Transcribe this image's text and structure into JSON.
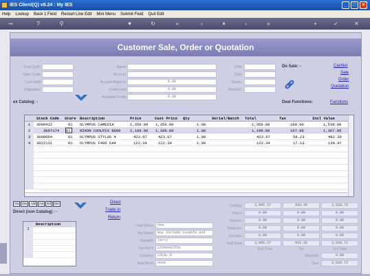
{
  "window": {
    "title": "IES Client(Q) v8.24 : My IES"
  },
  "menu": [
    "Help",
    "Lookup",
    "Back 1 Field",
    "Restart Line Edit",
    "Mini Menu",
    "Submit Field",
    "Quit Edit"
  ],
  "page": {
    "heading": "Customer Sale, Order or Quotation"
  },
  "customer_labels": {
    "find_cust": "Find Cust?",
    "sales_code": "Sales Code",
    "cust_ord": "Cust Ord#",
    "origination": "Origination",
    "name": "Name",
    "account": "Account",
    "account_balance": "Account Balance",
    "credit_limit": "Credit Limit",
    "available_credit": "Available Credit",
    "crm": "CRM",
    "club": "Club",
    "expiry": "Expiry",
    "directive": "Directive"
  },
  "customer_values": {
    "account_balance": "0.00",
    "credit_limit": "0.00",
    "available_credit": "0.00"
  },
  "do_sale": {
    "label": "Do Sale: -",
    "links": [
      "Cashier",
      "Sale",
      "Order",
      "Quotation"
    ]
  },
  "deal_functions": {
    "label": "Deal Functions:",
    "link": "Functions"
  },
  "catalog_label": "ex Catalog: -",
  "grid": {
    "headers": [
      "Stock Code",
      "Store",
      "Description",
      "Price",
      "Cust Price",
      "Qty",
      "Serial/Batch",
      "Total",
      "Tax",
      "Incl Value"
    ],
    "rows": [
      {
        "n": "1",
        "stock": "3008412",
        "store": "01",
        "desc": "OLYMPUS CAMEDIA",
        "price": "1,350.00",
        "cust_price": "1,350.00",
        "qty": "1.00",
        "total": "1,350.00",
        "tax": "189.00",
        "incl": "1,539.00"
      },
      {
        "n": "2",
        "stock": "3007174",
        "store": "01",
        "desc": "NIKON COOLPIX 8800",
        "price": "1,199.96",
        "cust_price": "1,199.96",
        "qty": "1.00",
        "total": "1,199.96",
        "tax": "167.99",
        "incl": "1,367.95"
      },
      {
        "n": "3",
        "stock": "3008064",
        "store": "01",
        "desc": "OLYMPUS STYLUS 4",
        "price": "423.07",
        "cust_price": "423.07",
        "qty": "1.00",
        "total": "423.07",
        "tax": "59.23",
        "incl": "482.30"
      },
      {
        "n": "4",
        "stock": "3022131",
        "store": "01",
        "desc": "OLYMPUS F400 FA4",
        "price": "122.34",
        "cust_price": "122.34",
        "qty": "1.00",
        "total": "122.34",
        "tax": "17.13",
        "incl": "139.47"
      }
    ]
  },
  "tabs": [
    "Vw",
    "Dte",
    "Add",
    "Ins",
    "Ed",
    "Del"
  ],
  "direct": {
    "label": "Direct (non Catalog) : -",
    "links": [
      "Direct",
      "Trade In",
      "Return"
    ]
  },
  "sub_grid": {
    "header": "Description",
    "first_row": "1"
  },
  "deal": {
    "labels": [
      "Deal Status",
      "Tax Status",
      "Operator",
      "Sys Ref #",
      "Currency",
      "Rate Book"
    ],
    "values": [
      "new",
      "may include taxable and",
      "Terry",
      "1534669255&",
      "LOCAL R",
      "none"
    ]
  },
  "totals": {
    "labels": [
      "Catalog",
      "Direct",
      "Returns",
      "Trade-Ins",
      "Specials",
      "Nett Total"
    ],
    "excl": [
      "3,095.37",
      "0.00",
      "0.00",
      "0.00",
      "0.00",
      "3,095.37"
    ],
    "tax": [
      "433.35",
      "0.00",
      "0.00",
      "0.00",
      "0.00",
      "433.35"
    ],
    "incl": [
      "3,528.72",
      "0.00",
      "0.00",
      "0.00",
      "0.00",
      "3,528.72"
    ],
    "col_labels": [
      "Excl Total",
      "Tax",
      "Incl Total"
    ],
    "deposits_label": "Deposits",
    "deposits": "0.00",
    "due_label": "Due",
    "due": "3,528.72"
  },
  "colors": {
    "header": "#8c8cc4",
    "titlebar": "#1b4fa8",
    "link": "#2020b0"
  }
}
